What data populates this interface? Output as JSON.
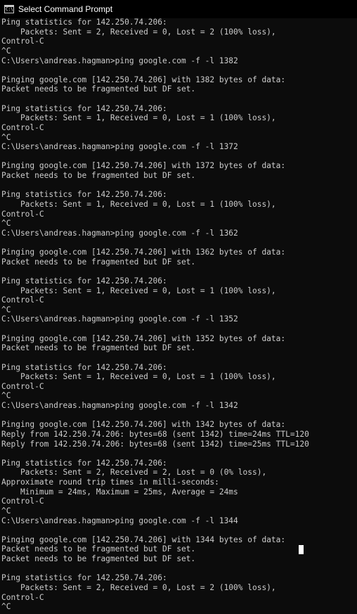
{
  "window": {
    "title": "Select Command Prompt",
    "icon": "cmd-icon"
  },
  "console": {
    "lines": [
      "Ping statistics for 142.250.74.206:",
      "    Packets: Sent = 2, Received = 0, Lost = 2 (100% loss),",
      "Control-C",
      "^C",
      "C:\\Users\\andreas.hagman>ping google.com -f -l 1382",
      "",
      "Pinging google.com [142.250.74.206] with 1382 bytes of data:",
      "Packet needs to be fragmented but DF set.",
      "",
      "Ping statistics for 142.250.74.206:",
      "    Packets: Sent = 1, Received = 0, Lost = 1 (100% loss),",
      "Control-C",
      "^C",
      "C:\\Users\\andreas.hagman>ping google.com -f -l 1372",
      "",
      "Pinging google.com [142.250.74.206] with 1372 bytes of data:",
      "Packet needs to be fragmented but DF set.",
      "",
      "Ping statistics for 142.250.74.206:",
      "    Packets: Sent = 1, Received = 0, Lost = 1 (100% loss),",
      "Control-C",
      "^C",
      "C:\\Users\\andreas.hagman>ping google.com -f -l 1362",
      "",
      "Pinging google.com [142.250.74.206] with 1362 bytes of data:",
      "Packet needs to be fragmented but DF set.",
      "",
      "Ping statistics for 142.250.74.206:",
      "    Packets: Sent = 1, Received = 0, Lost = 1 (100% loss),",
      "Control-C",
      "^C",
      "C:\\Users\\andreas.hagman>ping google.com -f -l 1352",
      "",
      "Pinging google.com [142.250.74.206] with 1352 bytes of data:",
      "Packet needs to be fragmented but DF set.",
      "",
      "Ping statistics for 142.250.74.206:",
      "    Packets: Sent = 1, Received = 0, Lost = 1 (100% loss),",
      "Control-C",
      "^C",
      "C:\\Users\\andreas.hagman>ping google.com -f -l 1342",
      "",
      "Pinging google.com [142.250.74.206] with 1342 bytes of data:",
      "Reply from 142.250.74.206: bytes=68 (sent 1342) time=24ms TTL=120",
      "Reply from 142.250.74.206: bytes=68 (sent 1342) time=25ms TTL=120",
      "",
      "Ping statistics for 142.250.74.206:",
      "    Packets: Sent = 2, Received = 2, Lost = 0 (0% loss),",
      "Approximate round trip times in milli-seconds:",
      "    Minimum = 24ms, Maximum = 25ms, Average = 24ms",
      "Control-C",
      "^C",
      "C:\\Users\\andreas.hagman>ping google.com -f -l 1344",
      "",
      "Pinging google.com [142.250.74.206] with 1344 bytes of data:",
      "Packet needs to be fragmented but DF set.",
      "Packet needs to be fragmented but DF set.",
      "",
      "Ping statistics for 142.250.74.206:",
      "    Packets: Sent = 2, Received = 0, Lost = 2 (100% loss),",
      "Control-C",
      "^C"
    ]
  }
}
